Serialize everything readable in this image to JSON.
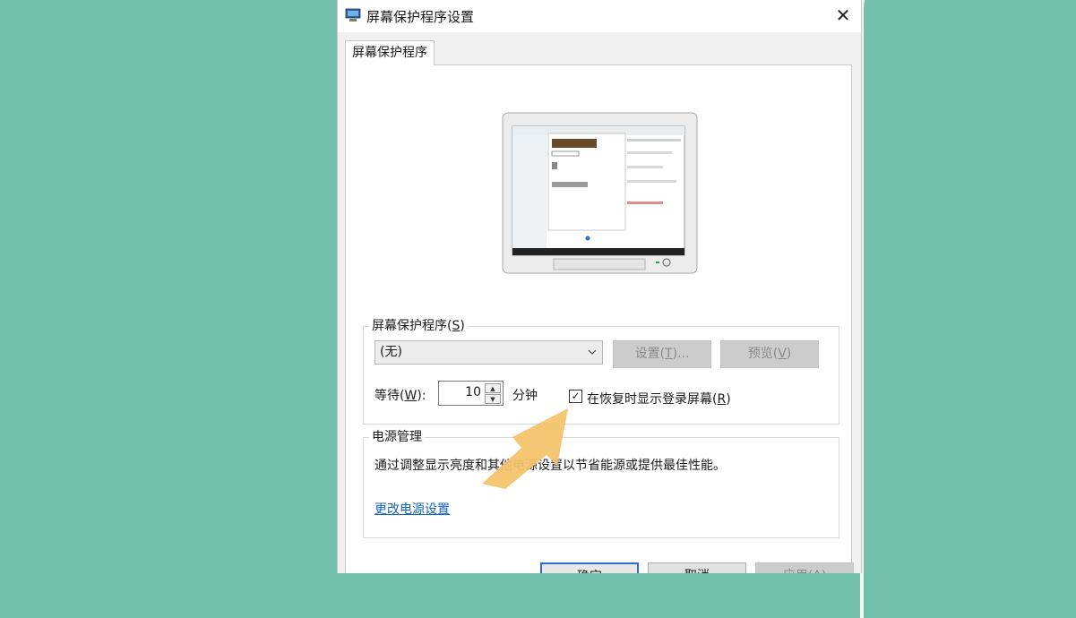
{
  "window": {
    "title": "屏幕保护程序设置",
    "close_glyph": "✕"
  },
  "tabs": [
    {
      "label": "屏幕保护程序"
    }
  ],
  "screensaver": {
    "legend_prefix": "屏幕保护程序(",
    "legend_key": "S",
    "legend_suffix": ")",
    "selected": "(无)",
    "settings_prefix": "设置(",
    "settings_key": "T",
    "settings_suffix": ")...",
    "preview_prefix": "预览(",
    "preview_key": "V",
    "preview_suffix": ")",
    "wait_prefix": "等待(",
    "wait_key": "W",
    "wait_suffix": "):",
    "wait_value": "10",
    "wait_unit": "分钟",
    "logon_checked": true,
    "logon_prefix": "在恢复时显示登录屏幕(",
    "logon_key": "R",
    "logon_suffix": ")"
  },
  "power": {
    "legend": "电源管理",
    "description": "通过调整显示亮度和其他电源设置以节省能源或提供最佳性能。",
    "link": "更改电源设置"
  },
  "buttons": {
    "ok": "确定",
    "cancel": "取消",
    "apply": "应用(A)"
  },
  "icons": {
    "app": "screensaver-monitor-icon",
    "close": "close-icon",
    "dropdown": "chevron-down-icon",
    "check": "checkmark-icon",
    "annotation": "yellow-arrow"
  },
  "colors": {
    "background": "#73c1aa",
    "link": "#1565c0",
    "annotation_arrow": "#f4c36b",
    "ok_border": "#2a6fd0"
  }
}
